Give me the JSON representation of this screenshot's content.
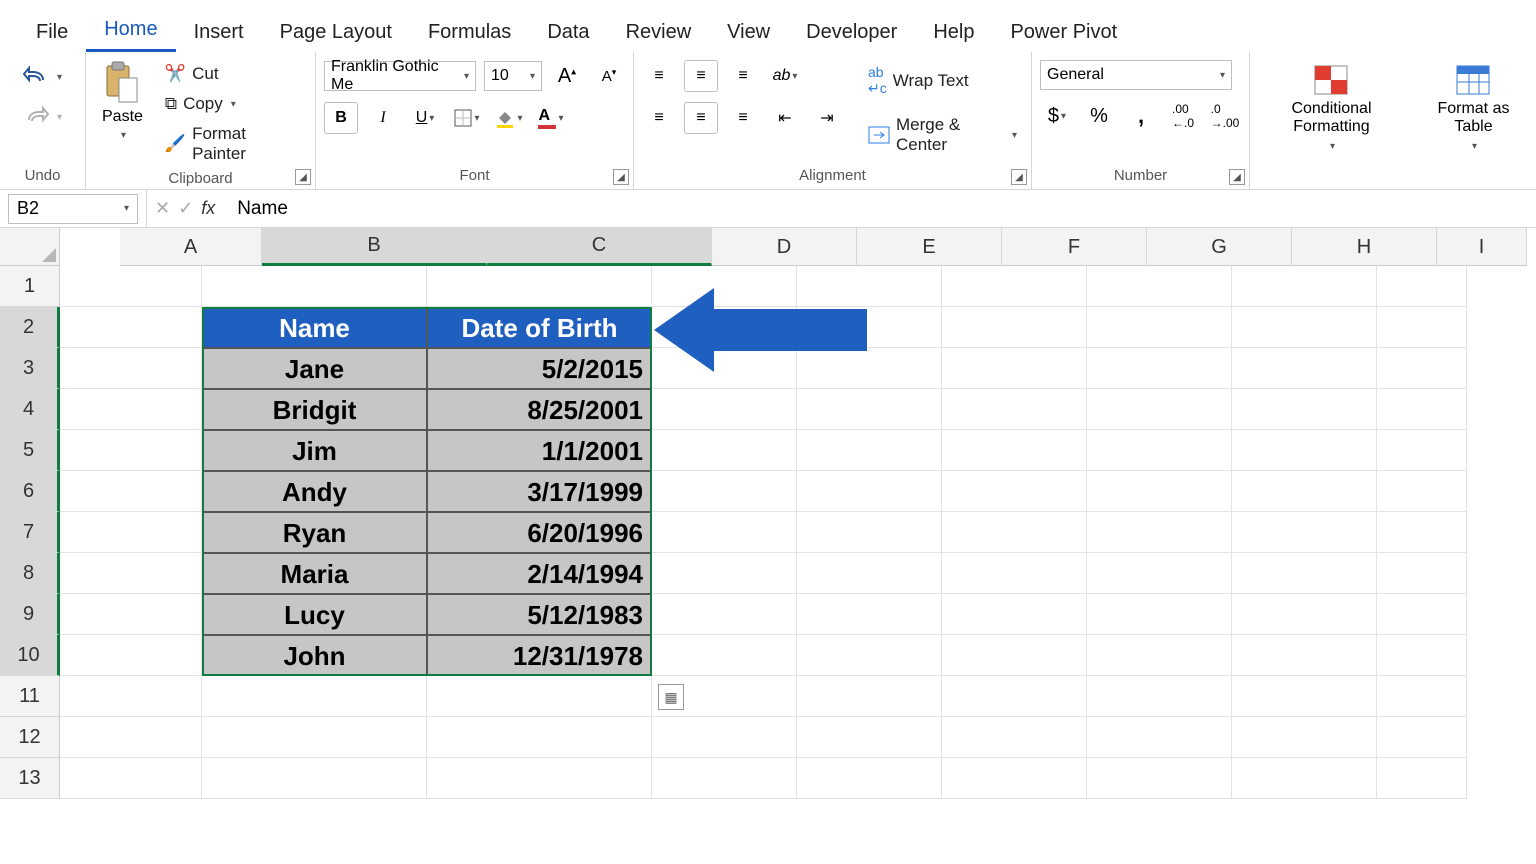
{
  "tabs": [
    "File",
    "Home",
    "Insert",
    "Page Layout",
    "Formulas",
    "Data",
    "Review",
    "View",
    "Developer",
    "Help",
    "Power Pivot"
  ],
  "active_tab": "Home",
  "ribbon": {
    "undo_label": "Undo",
    "clipboard": {
      "paste": "Paste",
      "cut": "Cut",
      "copy": "Copy",
      "painter": "Format Painter",
      "label": "Clipboard"
    },
    "font": {
      "name": "Franklin Gothic Me",
      "size": "10",
      "label": "Font"
    },
    "alignment": {
      "wrap": "Wrap Text",
      "merge": "Merge & Center",
      "label": "Alignment"
    },
    "number": {
      "format": "General",
      "label": "Number"
    },
    "styles": {
      "cond": "Conditional Formatting",
      "fat": "Format as Table"
    }
  },
  "namebox": "B2",
  "formula_value": "Name",
  "columns": [
    "A",
    "B",
    "C",
    "D",
    "E",
    "F",
    "G",
    "H",
    "I"
  ],
  "row_numbers": [
    1,
    2,
    3,
    4,
    5,
    6,
    7,
    8,
    9,
    10,
    11,
    12,
    13
  ],
  "table": {
    "headers": [
      "Name",
      "Date of Birth"
    ],
    "rows": [
      {
        "name": "Jane",
        "dob": "5/2/2015"
      },
      {
        "name": "Bridgit",
        "dob": "8/25/2001"
      },
      {
        "name": "Jim",
        "dob": "1/1/2001"
      },
      {
        "name": "Andy",
        "dob": "3/17/1999"
      },
      {
        "name": "Ryan",
        "dob": "6/20/1996"
      },
      {
        "name": "Maria",
        "dob": "2/14/1994"
      },
      {
        "name": "Lucy",
        "dob": "5/12/1983"
      },
      {
        "name": "John",
        "dob": "12/31/1978"
      }
    ]
  }
}
